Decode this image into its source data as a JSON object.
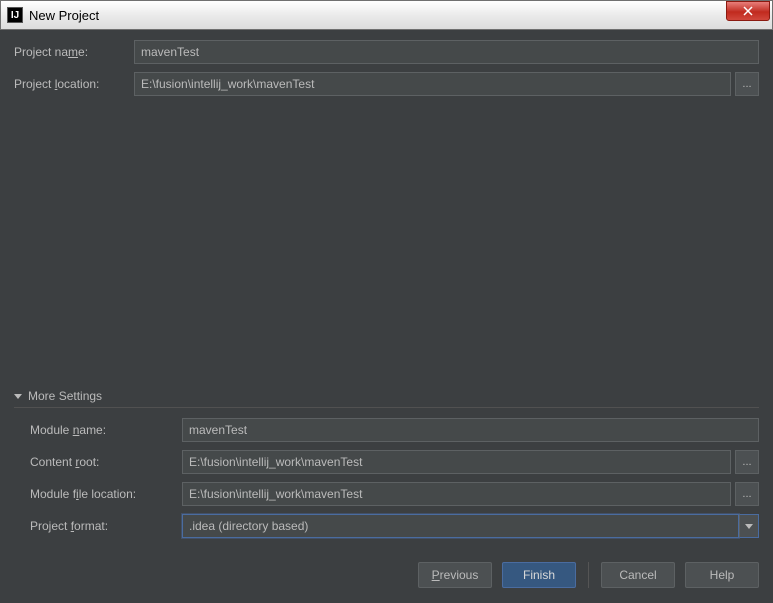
{
  "titlebar": {
    "title": "New Project",
    "icon_text": "IJ"
  },
  "top_form": {
    "project_name_label": "Project name:",
    "project_name_value": "mavenTest",
    "project_location_label": "Project location:",
    "project_location_value": "E:\\fusion\\intellij_work\\mavenTest",
    "browse_label": "..."
  },
  "more_settings": {
    "header": "More Settings",
    "module_name_label": "Module name:",
    "module_name_value": "mavenTest",
    "content_root_label": "Content root:",
    "content_root_value": "E:\\fusion\\intellij_work\\mavenTest",
    "module_file_location_label": "Module file location:",
    "module_file_location_value": "E:\\fusion\\intellij_work\\mavenTest",
    "project_format_label": "Project format:",
    "project_format_value": ".idea (directory based)",
    "browse_label": "..."
  },
  "buttons": {
    "previous": "Previous",
    "finish": "Finish",
    "cancel": "Cancel",
    "help": "Help"
  }
}
